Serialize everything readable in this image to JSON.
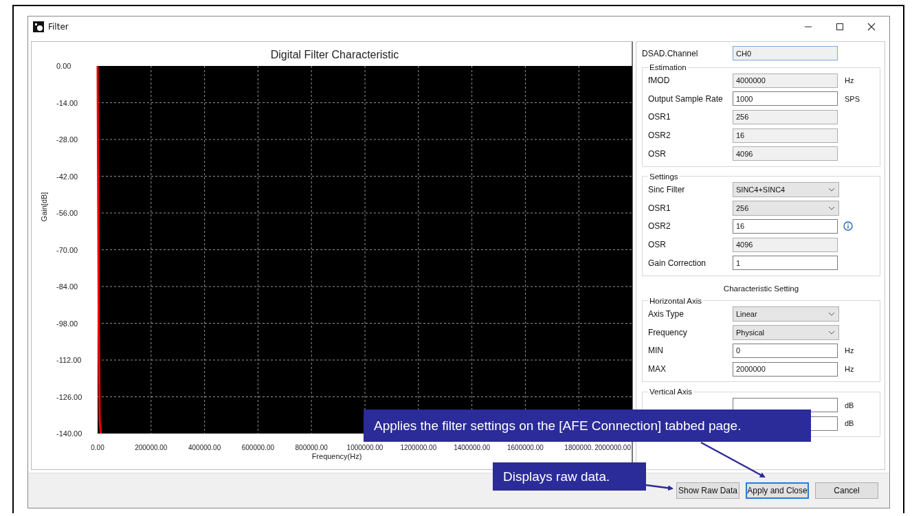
{
  "window": {
    "title": "Filter"
  },
  "chart": {
    "chart_data": {
      "type": "line",
      "title": "Digital Filter Characteristic",
      "xlabel": "Frequency(Hz)",
      "ylabel": "Gain[dB]",
      "x": [
        0,
        4000,
        8000,
        12000
      ],
      "series": [
        {
          "color": "#ff0000",
          "values": [
            0,
            -98,
            -135,
            -140
          ]
        }
      ],
      "grid": true,
      "xlim": [
        0,
        2000000
      ],
      "ylim": [
        -140,
        0
      ],
      "xticks": [
        {
          "value": 0,
          "label": "0.00"
        },
        {
          "value": 200000,
          "label": "200000.00"
        },
        {
          "value": 400000,
          "label": "400000.00"
        },
        {
          "value": 600000,
          "label": "600000.00"
        },
        {
          "value": 800000,
          "label": "800000.00"
        },
        {
          "value": 1000000,
          "label": "1000000.00"
        },
        {
          "value": 1200000,
          "label": "1200000.00"
        },
        {
          "value": 1400000,
          "label": "1400000.00"
        },
        {
          "value": 1600000,
          "label": "1600000.00"
        },
        {
          "value": 1800000,
          "label": "1800000."
        },
        {
          "value": 2000000,
          "label": "2000000.00"
        }
      ],
      "yticks": [
        {
          "value": 0,
          "label": "0.00"
        },
        {
          "value": -14,
          "label": "-14.00"
        },
        {
          "value": -28,
          "label": "-28.00"
        },
        {
          "value": -42,
          "label": "-42.00"
        },
        {
          "value": -56,
          "label": "-56.00"
        },
        {
          "value": -70,
          "label": "-70.00"
        },
        {
          "value": -84,
          "label": "-84.00"
        },
        {
          "value": -98,
          "label": "-98.00"
        },
        {
          "value": -112,
          "label": "-112.00"
        },
        {
          "value": -126,
          "label": "-126.00"
        },
        {
          "value": -140,
          "label": "-140.00"
        }
      ]
    }
  },
  "channel": {
    "label": "DSAD.Channel",
    "value": "CH0"
  },
  "estimation": {
    "title": "Estimation",
    "rows": [
      {
        "label": "fMOD",
        "kind": "text",
        "value": "4000000",
        "readonly": true,
        "unit": "Hz"
      },
      {
        "label": "Output Sample Rate",
        "kind": "text",
        "value": "1000",
        "readonly": false,
        "unit": "SPS"
      },
      {
        "label": "OSR1",
        "kind": "text",
        "value": "256",
        "readonly": true
      },
      {
        "label": "OSR2",
        "kind": "text",
        "value": "16",
        "readonly": true
      },
      {
        "label": "OSR",
        "kind": "text",
        "value": "4096",
        "readonly": true
      }
    ]
  },
  "settings": {
    "title": "Settings",
    "rows": [
      {
        "label": "Sinc Filter",
        "kind": "select",
        "value": "SINC4+SINC4"
      },
      {
        "label": "OSR1",
        "kind": "select",
        "value": "256"
      },
      {
        "label": "OSR2",
        "kind": "text",
        "value": "16",
        "readonly": false,
        "info": true
      },
      {
        "label": "OSR",
        "kind": "text",
        "value": "4096",
        "readonly": true
      },
      {
        "label": "Gain Correction",
        "kind": "text",
        "value": "1",
        "readonly": false
      }
    ]
  },
  "characteristic_setting": {
    "title": "Characteristic Setting",
    "groups": [
      {
        "title": "Horizontal Axis",
        "rows": [
          {
            "label": "Axis Type",
            "kind": "select",
            "value": "Linear"
          },
          {
            "label": "Frequency",
            "kind": "select",
            "value": "Physical"
          },
          {
            "label": "MIN",
            "kind": "text",
            "value": "0",
            "readonly": false,
            "unit": "Hz"
          },
          {
            "label": "MAX",
            "kind": "text",
            "value": "2000000",
            "readonly": false,
            "unit": "Hz"
          }
        ]
      },
      {
        "title": "Vertical Axis",
        "rows": [
          {
            "kind": "text",
            "readonly": false,
            "unit": "dB"
          },
          {
            "kind": "text",
            "readonly": false,
            "unit": "dB"
          }
        ]
      }
    ]
  },
  "buttons": [
    {
      "label": "Show Raw Data",
      "focused": false
    },
    {
      "label": "Apply and Close",
      "focused": true
    },
    {
      "label": "Cancel",
      "focused": false
    }
  ],
  "callouts": [
    {
      "text": "Applies the filter settings on the [AFE Connection] tabbed page."
    },
    {
      "text": "Displays raw data."
    }
  ]
}
